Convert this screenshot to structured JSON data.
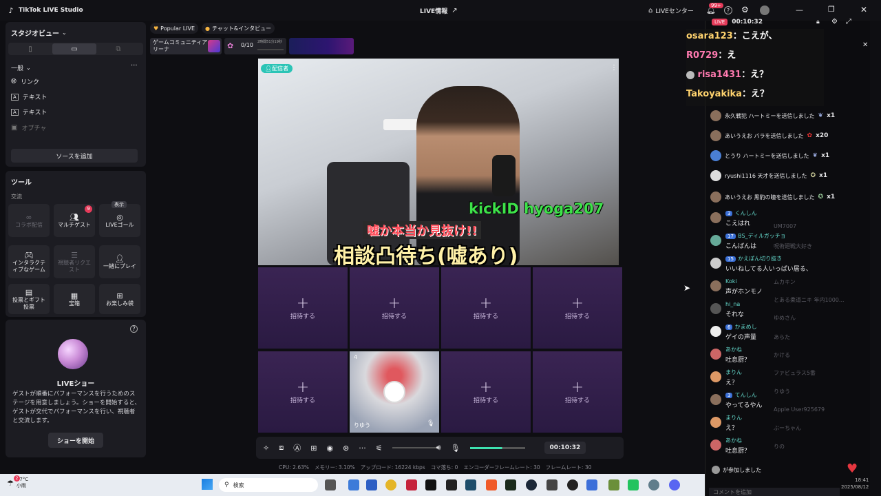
{
  "app": {
    "title": "TikTok LIVE Studio",
    "center_title": "LIVE情報",
    "live_center": "LIVEセンター",
    "badge_99": "99+",
    "timer_top": "00:10:32",
    "live_tag": "LIVE"
  },
  "left": {
    "studio_view": "スタジオビュー",
    "general": "一般",
    "sources": [
      "リンク",
      "テキスト",
      "テキスト",
      "オプチャ"
    ],
    "add_source": "ソースを追加",
    "tools": "ツール",
    "exchange": "交流",
    "tools_list": [
      {
        "label": "コラボ配信",
        "dim": true
      },
      {
        "label": "マルチゲスト",
        "badge": "9"
      },
      {
        "label": "LIVEゴール",
        "tip": "表示"
      },
      {
        "label": "インタラクテ\nィブなゲーム"
      },
      {
        "label": "視聴者リクエ\nスト",
        "dim": true
      },
      {
        "label": "一緒にプレイ"
      },
      {
        "label": "投票とギフト\n投票"
      },
      {
        "label": "宝箱"
      },
      {
        "label": "お楽しみ袋"
      }
    ],
    "show_title": "LIVEショー",
    "show_desc": "ゲストが順番にパフォーマンスを行うためのステージを用意しましょう。ショーを開始すると、ゲストが交代でパフォーマンスを行い、視聴者と交流します。",
    "show_button": "ショーを開始"
  },
  "tabs": {
    "popular": "Popular LIVE",
    "chat": "チャット&インタビュー"
  },
  "banner": {
    "arena": "ゲームコミュニティア\nリーナ",
    "progress": "0/10",
    "time": "2時間51分19秒"
  },
  "stream": {
    "host_tag": "配信者",
    "kick": "kickID hyoga207",
    "caption1": "嘘か本当か見抜け!!",
    "caption2": "相談凸待ち(嘘あり)"
  },
  "slots": {
    "invite": "招待する",
    "guest_name": "りゆう",
    "guest_count": "4"
  },
  "controls": {
    "timer": "00:10:32"
  },
  "status": {
    "cpu": "CPU: 2.63%",
    "memory": "メモリー: 3.10%",
    "upload": "アップロード: 16224 kbps",
    "drop": "コマ落ち: 0",
    "encoder": "エンコーダーフレームレート: 30",
    "fps": "フレームレート: 30"
  },
  "overlay": {
    "chats": [
      {
        "user": "osara123",
        "msg": "：こえが、"
      },
      {
        "user": "R0729",
        "msg": "：え"
      },
      {
        "user": "risa1431",
        "msg": "：え？"
      },
      {
        "user": "Takoyakika",
        "msg": "：え？"
      }
    ]
  },
  "gifts": [
    {
      "text": "永久戦犯 ハートミーを送信しました",
      "count": "x1"
    },
    {
      "text": "あいうえお バラを送信しました",
      "count": "x20"
    },
    {
      "text": "とうり ハートミーを送信しました",
      "count": "x1"
    },
    {
      "text": "ryushi1116 天才を送信しました",
      "count": "x1"
    },
    {
      "text": "あいうえお 黒豹の瞳を送信しました",
      "count": "x1"
    }
  ],
  "chats": [
    {
      "lvl": "3",
      "user": "くんしん",
      "msg": "こえはれ"
    },
    {
      "lvl": "17",
      "user": "BS_ディルガッチョ",
      "msg": "こんばんは"
    },
    {
      "lvl": "15",
      "user": "かえぽん切り抜き",
      "msg": "いいねしてる人いっぱい居る、"
    },
    {
      "lvl": "",
      "user": "Koki",
      "msg": "声がホンモノ"
    },
    {
      "lvl": "",
      "user": "hi_na",
      "msg": "それな"
    },
    {
      "lvl": "6",
      "user": "かまめし",
      "msg": "ゲイの声量"
    },
    {
      "lvl": "",
      "user": "あかね",
      "msg": "吐息厨？"
    },
    {
      "lvl": "",
      "user": "まりん",
      "msg": "え？"
    },
    {
      "lvl": "3",
      "user": "てんしん",
      "msg": "やってるやん"
    },
    {
      "lvl": "",
      "user": "まりん",
      "msg": "え？"
    },
    {
      "lvl": "",
      "user": "あかね",
      "msg": "吐息厨？"
    }
  ],
  "joined": "が参加しました",
  "comment_placeholder": "コメントを追加",
  "ranking": [
    "UM7007",
    "呪術廻戦大好き",
    "ムカキン",
    "とある柔道ニキ 年内1000...",
    "ゆめさん",
    "あらた",
    "かける",
    "ファビュラス5番",
    "りゆう",
    "Apple User925679",
    "ぶーちゃん",
    "りの"
  ],
  "taskbar": {
    "temp": "27°C",
    "weather": "小雨",
    "search": "検索",
    "time": "18:41",
    "date": "2025/08/12",
    "notif": "2"
  }
}
